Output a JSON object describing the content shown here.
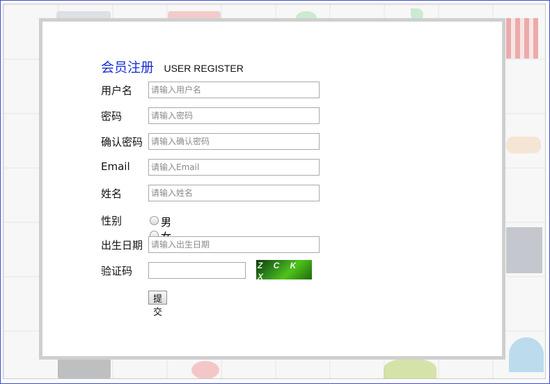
{
  "form": {
    "title_cn": "会员注册",
    "title_en": "USER REGISTER",
    "fields": [
      {
        "label": "用户名",
        "placeholder": "请输入用户名"
      },
      {
        "label": "密码",
        "placeholder": "请输入密码"
      },
      {
        "label": "确认密码",
        "placeholder": "请输入确认密码"
      },
      {
        "label": "Email",
        "placeholder": "请输入Email"
      },
      {
        "label": "姓名",
        "placeholder": "请输入姓名"
      }
    ],
    "gender": {
      "label": "性别",
      "options": [
        "男",
        "女"
      ]
    },
    "birthday": {
      "label": "出生日期",
      "placeholder": "请输入出生日期"
    },
    "captcha": {
      "label": "验证码",
      "value": "",
      "image_text": "Z C K X"
    },
    "submit_label": "提交"
  },
  "colors": {
    "title": "#1a2fd4",
    "frame": "#3b4bd0",
    "card_border": "#cfcfcf"
  }
}
